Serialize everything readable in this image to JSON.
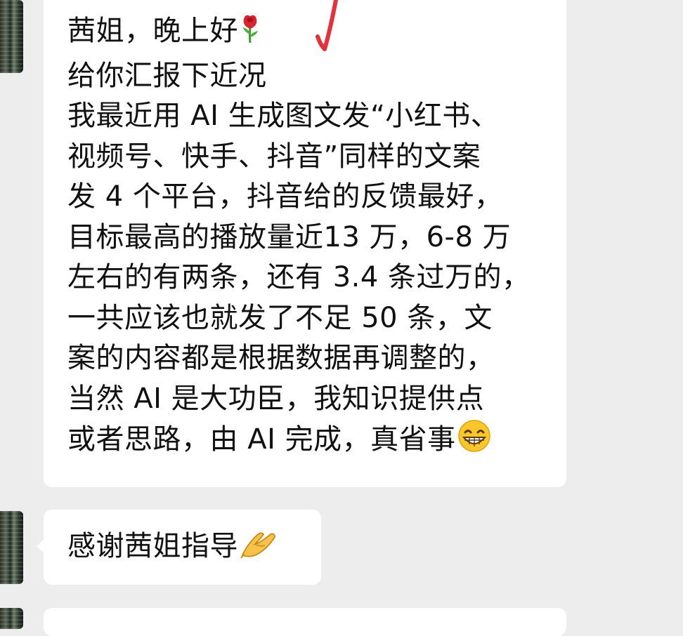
{
  "chat": {
    "messages": [
      {
        "lines": [
          "茜姐，晚上好",
          "给你汇报下近况",
          "我最近用 AI 生成图文发“小红书、",
          "视频号、快手、抖音”同样的文案",
          "发 4 个平台，抖音给的反馈最好，",
          "目标最高的播放量近13 万，6-8 万",
          "左右的有两条，还有 3.4 条过万的，",
          "一共应该也就发了不足 50 条，文",
          "案的内容都是根据数据再调整的，",
          "当然 AI 是大功臣，我知识提供点",
          "或者思路，由 AI 完成，真省事"
        ],
        "emojis": [
          "rose-emoji",
          "grinning-face-emoji"
        ]
      },
      {
        "lines": [
          "感谢茜姐指导"
        ],
        "emojis": [
          "folded-hands-emoji"
        ]
      }
    ]
  },
  "colors": {
    "background": "#ededed",
    "bubble": "#ffffff",
    "text": "#111111",
    "check_mark": "#e8303d"
  }
}
